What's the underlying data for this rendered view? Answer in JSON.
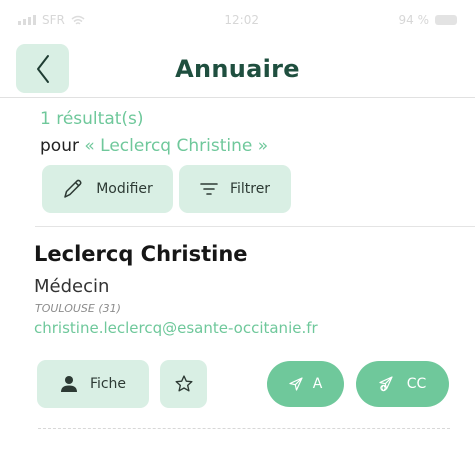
{
  "status_bar": {
    "carrier": "SFR",
    "time": "12:02",
    "battery": "94 %"
  },
  "header": {
    "title": "Annuaire",
    "back_icon": "chevron-left-icon"
  },
  "results": {
    "count_text": "1 résultat(s)",
    "query_prefix": "pour ",
    "query": "« Leclercq Christine »"
  },
  "actions": {
    "edit_label": "Modifier",
    "filter_label": "Filtrer"
  },
  "contact": {
    "name": "Leclercq Christine",
    "role": "Médecin",
    "city": "TOULOUSE (31)",
    "email": "christine.leclercq@esante-occitanie.fr",
    "fiche_label": "Fiche",
    "send_to_label": "A",
    "send_cc_label": "CC"
  },
  "colors": {
    "accent": "#6fc89b",
    "accent_light": "#d9efe4",
    "title": "#1f4f3f"
  }
}
